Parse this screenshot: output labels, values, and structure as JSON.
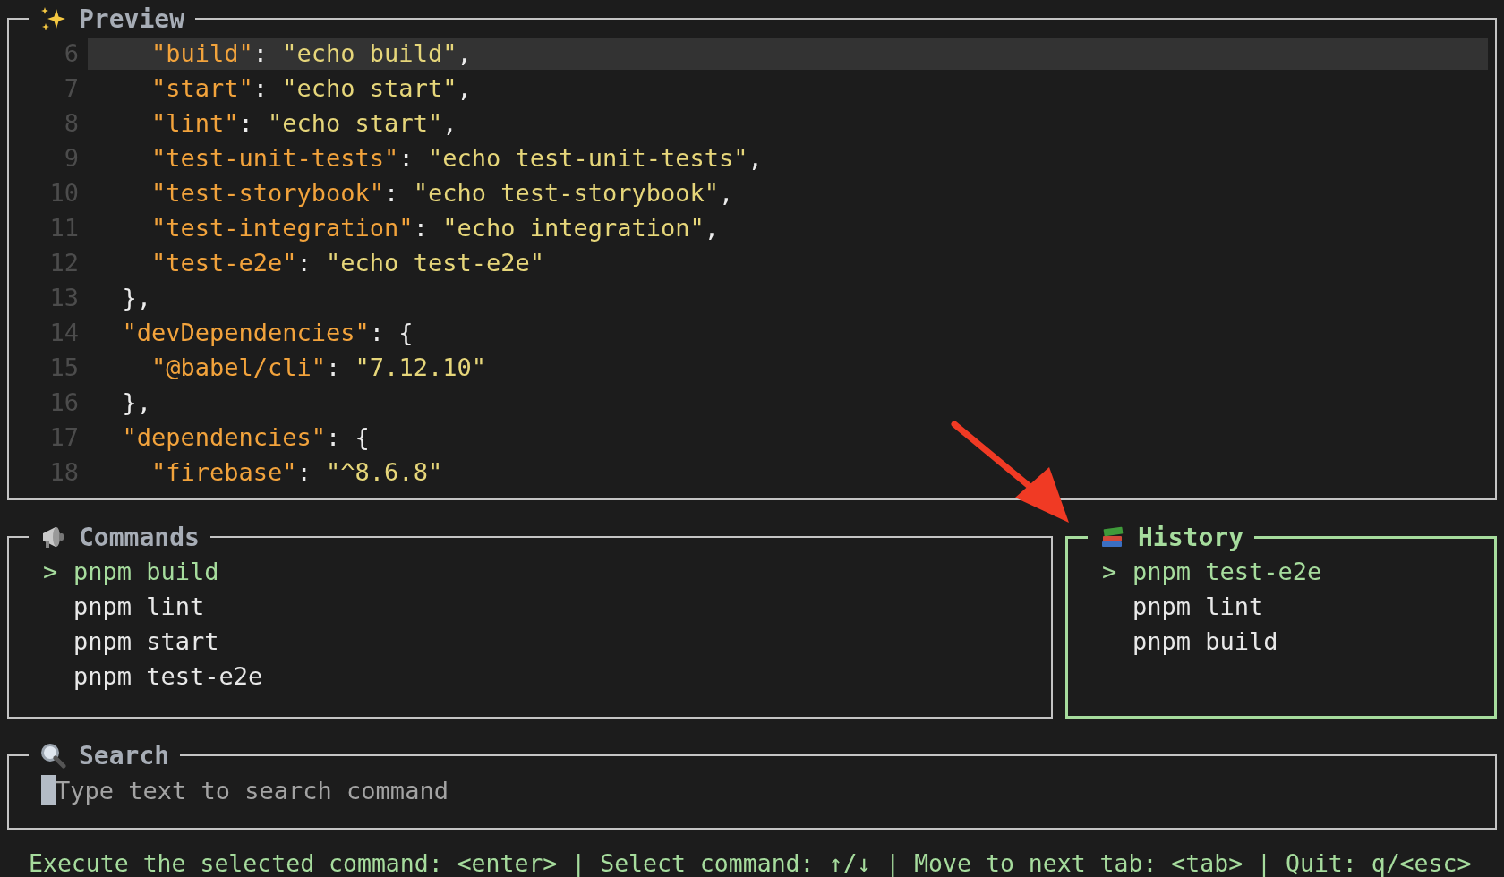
{
  "preview": {
    "title": "Preview",
    "lines": [
      {
        "number": "6",
        "highlighted": true,
        "tokens": [
          {
            "kind": "key",
            "text": "    \"build\""
          },
          {
            "kind": "punct",
            "text": ": "
          },
          {
            "kind": "string",
            "text": "\"echo build\""
          },
          {
            "kind": "punct",
            "text": ","
          }
        ]
      },
      {
        "number": "7",
        "highlighted": false,
        "tokens": [
          {
            "kind": "key",
            "text": "    \"start\""
          },
          {
            "kind": "punct",
            "text": ": "
          },
          {
            "kind": "string",
            "text": "\"echo start\""
          },
          {
            "kind": "punct",
            "text": ","
          }
        ]
      },
      {
        "number": "8",
        "highlighted": false,
        "tokens": [
          {
            "kind": "key",
            "text": "    \"lint\""
          },
          {
            "kind": "punct",
            "text": ": "
          },
          {
            "kind": "string",
            "text": "\"echo start\""
          },
          {
            "kind": "punct",
            "text": ","
          }
        ]
      },
      {
        "number": "9",
        "highlighted": false,
        "tokens": [
          {
            "kind": "key",
            "text": "    \"test-unit-tests\""
          },
          {
            "kind": "punct",
            "text": ": "
          },
          {
            "kind": "string",
            "text": "\"echo test-unit-tests\""
          },
          {
            "kind": "punct",
            "text": ","
          }
        ]
      },
      {
        "number": "10",
        "highlighted": false,
        "tokens": [
          {
            "kind": "key",
            "text": "    \"test-storybook\""
          },
          {
            "kind": "punct",
            "text": ": "
          },
          {
            "kind": "string",
            "text": "\"echo test-storybook\""
          },
          {
            "kind": "punct",
            "text": ","
          }
        ]
      },
      {
        "number": "11",
        "highlighted": false,
        "tokens": [
          {
            "kind": "key",
            "text": "    \"test-integration\""
          },
          {
            "kind": "punct",
            "text": ": "
          },
          {
            "kind": "string",
            "text": "\"echo integration\""
          },
          {
            "kind": "punct",
            "text": ","
          }
        ]
      },
      {
        "number": "12",
        "highlighted": false,
        "tokens": [
          {
            "kind": "key",
            "text": "    \"test-e2e\""
          },
          {
            "kind": "punct",
            "text": ": "
          },
          {
            "kind": "string",
            "text": "\"echo test-e2e\""
          }
        ]
      },
      {
        "number": "13",
        "highlighted": false,
        "tokens": [
          {
            "kind": "punct",
            "text": "  },"
          }
        ]
      },
      {
        "number": "14",
        "highlighted": false,
        "tokens": [
          {
            "kind": "key",
            "text": "  \"devDependencies\""
          },
          {
            "kind": "punct",
            "text": ": {"
          }
        ]
      },
      {
        "number": "15",
        "highlighted": false,
        "tokens": [
          {
            "kind": "key",
            "text": "    \"@babel/cli\""
          },
          {
            "kind": "punct",
            "text": ": "
          },
          {
            "kind": "string",
            "text": "\"7.12.10\""
          }
        ]
      },
      {
        "number": "16",
        "highlighted": false,
        "tokens": [
          {
            "kind": "punct",
            "text": "  },"
          }
        ]
      },
      {
        "number": "17",
        "highlighted": false,
        "tokens": [
          {
            "kind": "key",
            "text": "  \"dependencies\""
          },
          {
            "kind": "punct",
            "text": ": {"
          }
        ]
      },
      {
        "number": "18",
        "highlighted": false,
        "tokens": [
          {
            "kind": "key",
            "text": "    \"firebase\""
          },
          {
            "kind": "punct",
            "text": ": "
          },
          {
            "kind": "string",
            "text": "\"^8.6.8\""
          }
        ]
      }
    ]
  },
  "commands": {
    "title": "Commands",
    "focused": false,
    "cursor": ">",
    "items": [
      {
        "label": "pnpm build",
        "selected": true
      },
      {
        "label": "pnpm lint",
        "selected": false
      },
      {
        "label": "pnpm start",
        "selected": false
      },
      {
        "label": "pnpm test-e2e",
        "selected": false
      }
    ]
  },
  "history": {
    "title": "History",
    "focused": true,
    "cursor": ">",
    "items": [
      {
        "label": "pnpm test-e2e",
        "selected": true
      },
      {
        "label": "pnpm lint",
        "selected": false
      },
      {
        "label": "pnpm build",
        "selected": false
      }
    ]
  },
  "search": {
    "title": "Search",
    "placeholder": "Type text to search command"
  },
  "status_bar": "Execute the selected command: <enter> | Select command: ↑/↓ | Move to next tab: <tab> | Quit: q/<esc>"
}
